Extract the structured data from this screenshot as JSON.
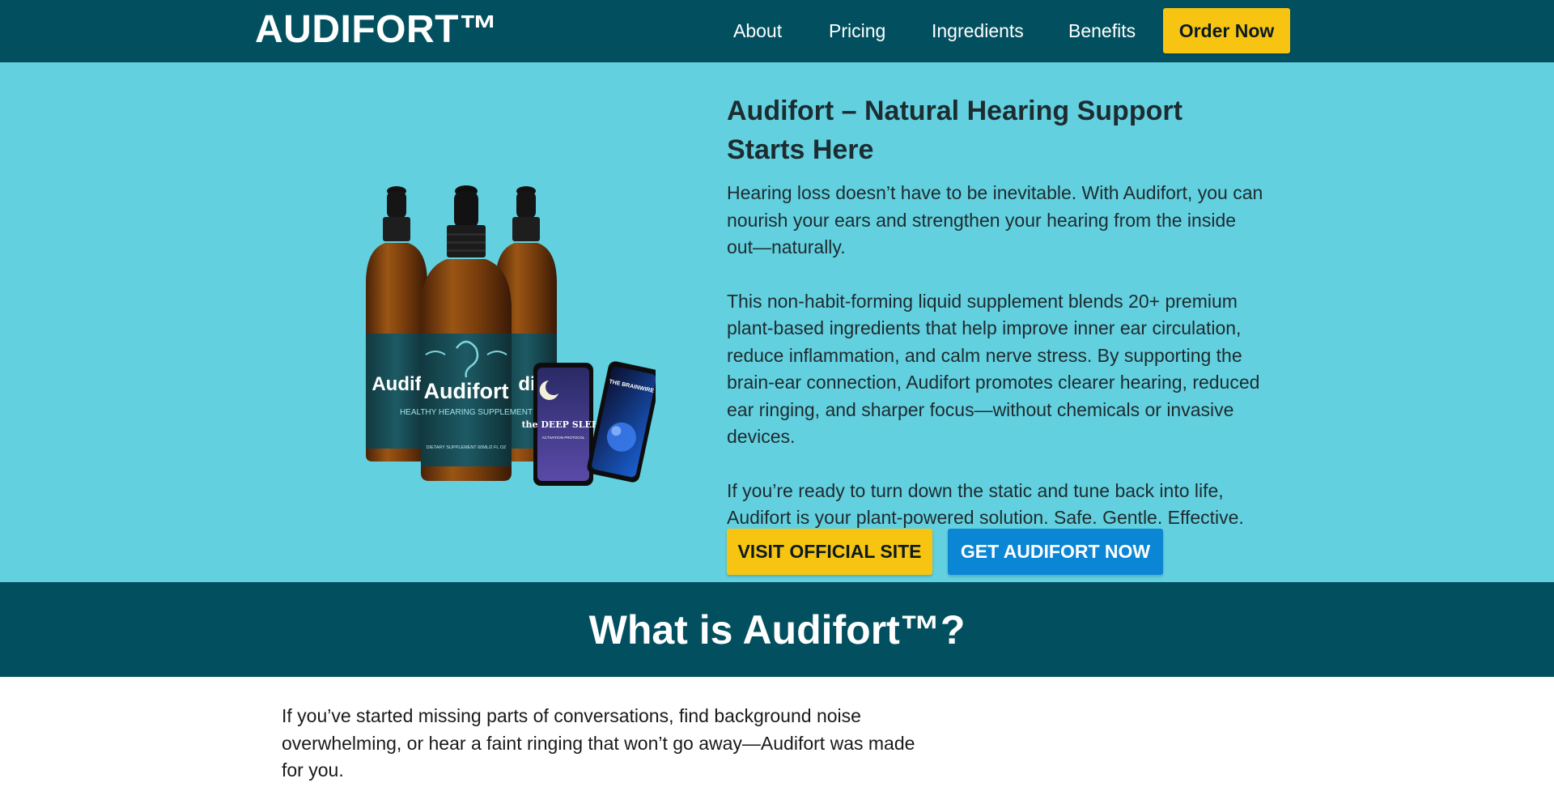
{
  "header": {
    "logo": "AUDIFORT™",
    "nav": [
      {
        "label": "About"
      },
      {
        "label": "Pricing"
      },
      {
        "label": "Ingredients"
      },
      {
        "label": "Benefits"
      }
    ],
    "cta_label": "Order Now"
  },
  "hero": {
    "title": "Audifort – Natural Hearing Support Starts Here",
    "paragraphs": [
      "Hearing loss doesn’t have to be inevitable. With Audifort, you can nourish your ears and strengthen your hearing from the inside out—naturally.",
      "This non-habit-forming liquid supplement blends 20+ premium plant-based ingredients that help improve inner ear circulation, reduce inflammation, and calm nerve stress. By supporting the brain-ear connection, Audifort promotes clearer hearing, reduced ear ringing, and sharper focus—without chemicals or invasive devices.",
      "If you’re ready to turn down the static and tune back into life, Audifort is your plant-powered solution. Safe. Gentle. Effective."
    ],
    "buttons": {
      "primary": "VISIT OFFICIAL SITE",
      "secondary": "GET AUDIFORT NOW"
    },
    "product_image": {
      "bottle_brand": "Audifort",
      "bottle_subtitle": "HEALTHY HEARING SUPPLEMENT",
      "bottle_fine_print": "DIETARY SUPPLEMENT 60ML/2 FL OZ",
      "bonus_1": "the DEEP SLEEP",
      "bonus_1_sub": "ACTIVATION PROTOCOL",
      "bonus_2": "THE BRAINWIRE"
    }
  },
  "section": {
    "title": "What is Audifort™?",
    "intro": "If you’ve started missing parts of conversations, find background noise overwhelming, or hear a faint ringing that won’t go away—Audifort was made for you."
  },
  "colors": {
    "header_bg": "#02505f",
    "hero_bg": "#62d0df",
    "accent_yellow": "#f7c511",
    "accent_blue": "#0b86d4"
  }
}
